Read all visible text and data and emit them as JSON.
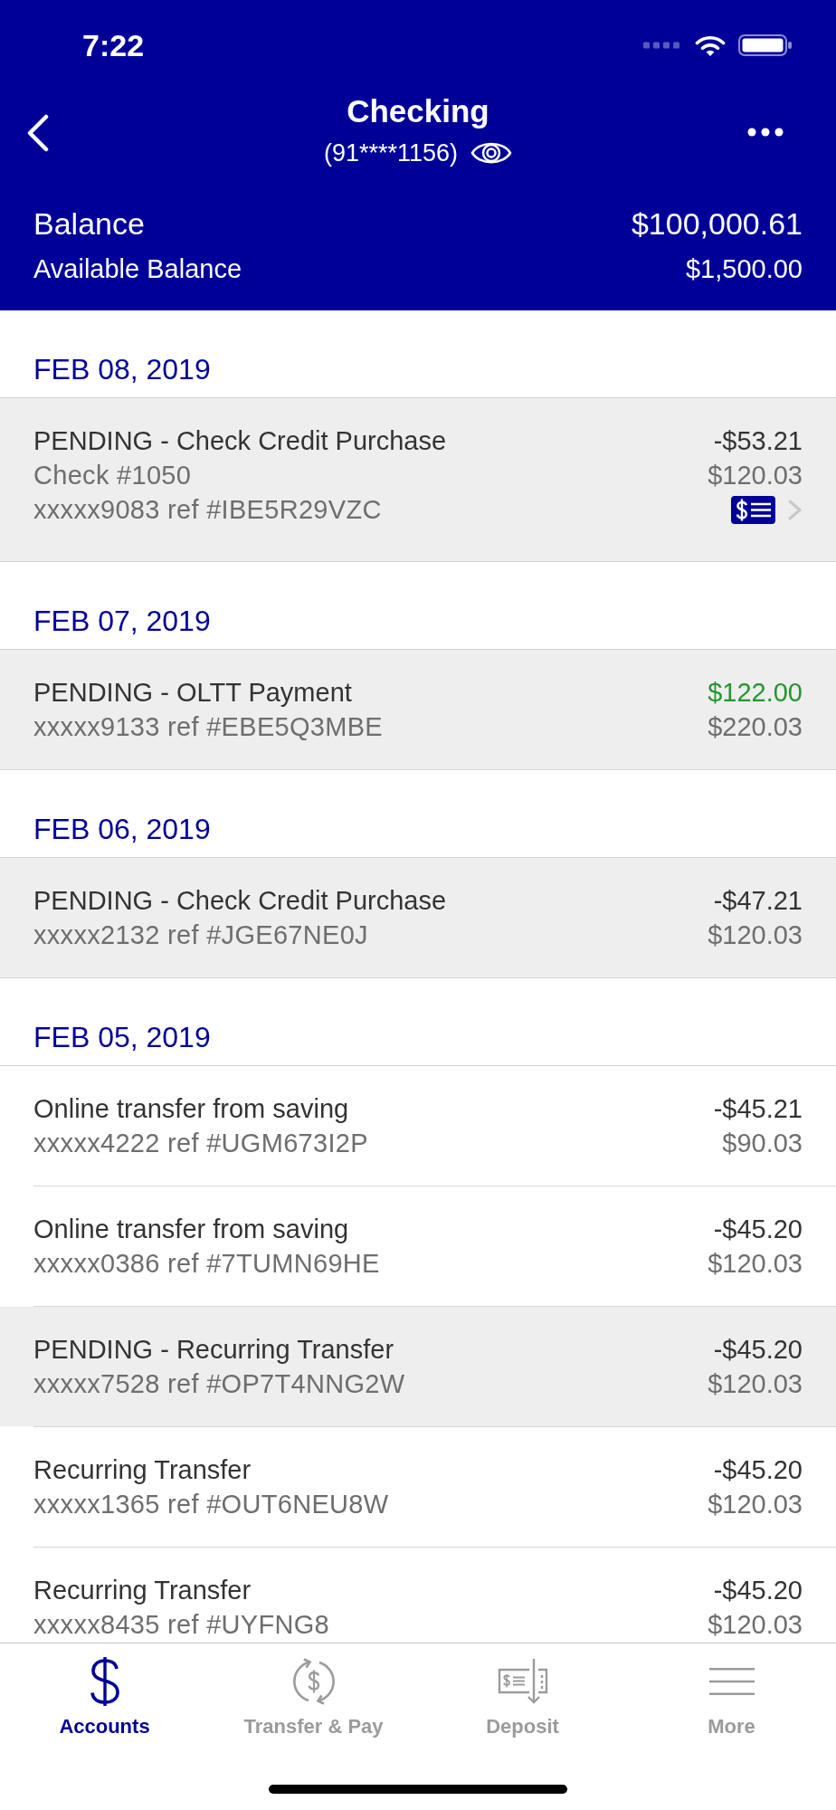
{
  "status_bar": {
    "time": "7:22"
  },
  "nav": {
    "title": "Checking",
    "account_number": "(91****1156)"
  },
  "balances": [
    {
      "kind": "primary",
      "label": "Balance",
      "amount": "$100,000.61"
    },
    {
      "kind": "secondary",
      "label": "Available Balance",
      "amount": "$1,500.00"
    }
  ],
  "sections": [
    {
      "date": "FEB 08, 2019",
      "transactions": [
        {
          "title": "PENDING - Check Credit Purchase",
          "details": [
            "Check #1050",
            "xxxxx9083 ref #IBE5R29VZC"
          ],
          "amount": "-$53.21",
          "balance": "$120.03",
          "pending": true,
          "credit": false,
          "has_check_image": true
        }
      ]
    },
    {
      "date": "FEB 07, 2019",
      "transactions": [
        {
          "title": "PENDING - OLTT Payment",
          "details": [
            "xxxxx9133 ref #EBE5Q3MBE"
          ],
          "amount": "$122.00",
          "balance": "$220.03",
          "pending": true,
          "credit": true,
          "has_check_image": false
        }
      ]
    },
    {
      "date": "FEB 06, 2019",
      "transactions": [
        {
          "title": "PENDING - Check Credit Purchase",
          "details": [
            "xxxxx2132 ref #JGE67NE0J"
          ],
          "amount": "-$47.21",
          "balance": "$120.03",
          "pending": true,
          "credit": false,
          "has_check_image": false
        }
      ]
    },
    {
      "date": "FEB 05, 2019",
      "transactions": [
        {
          "title": "Online transfer from saving",
          "details": [
            "xxxxx4222 ref #UGM673I2P"
          ],
          "amount": "-$45.21",
          "balance": "$90.03",
          "pending": false,
          "credit": false,
          "has_check_image": false
        },
        {
          "title": "Online transfer from saving",
          "details": [
            "xxxxx0386 ref #7TUMN69HE"
          ],
          "amount": "-$45.20",
          "balance": "$120.03",
          "pending": false,
          "credit": false,
          "has_check_image": false
        },
        {
          "title": "PENDING - Recurring Transfer",
          "details": [
            "xxxxx7528 ref #OP7T4NNG2W"
          ],
          "amount": "-$45.20",
          "balance": "$120.03",
          "pending": true,
          "credit": false,
          "has_check_image": false
        },
        {
          "title": "Recurring Transfer",
          "details": [
            "xxxxx1365 ref #OUT6NEU8W"
          ],
          "amount": "-$45.20",
          "balance": "$120.03",
          "pending": false,
          "credit": false,
          "has_check_image": false
        },
        {
          "title": "Recurring Transfer",
          "details": [
            "xxxxx8435 ref #UYFNG8"
          ],
          "amount": "-$45.20",
          "balance": "$120.03",
          "pending": false,
          "credit": false,
          "has_check_image": false
        }
      ]
    }
  ],
  "tab_bar": [
    {
      "label": "Accounts",
      "selected": true
    },
    {
      "label": "Transfer & Pay",
      "selected": false
    },
    {
      "label": "Deposit",
      "selected": false
    },
    {
      "label": "More",
      "selected": false
    }
  ]
}
